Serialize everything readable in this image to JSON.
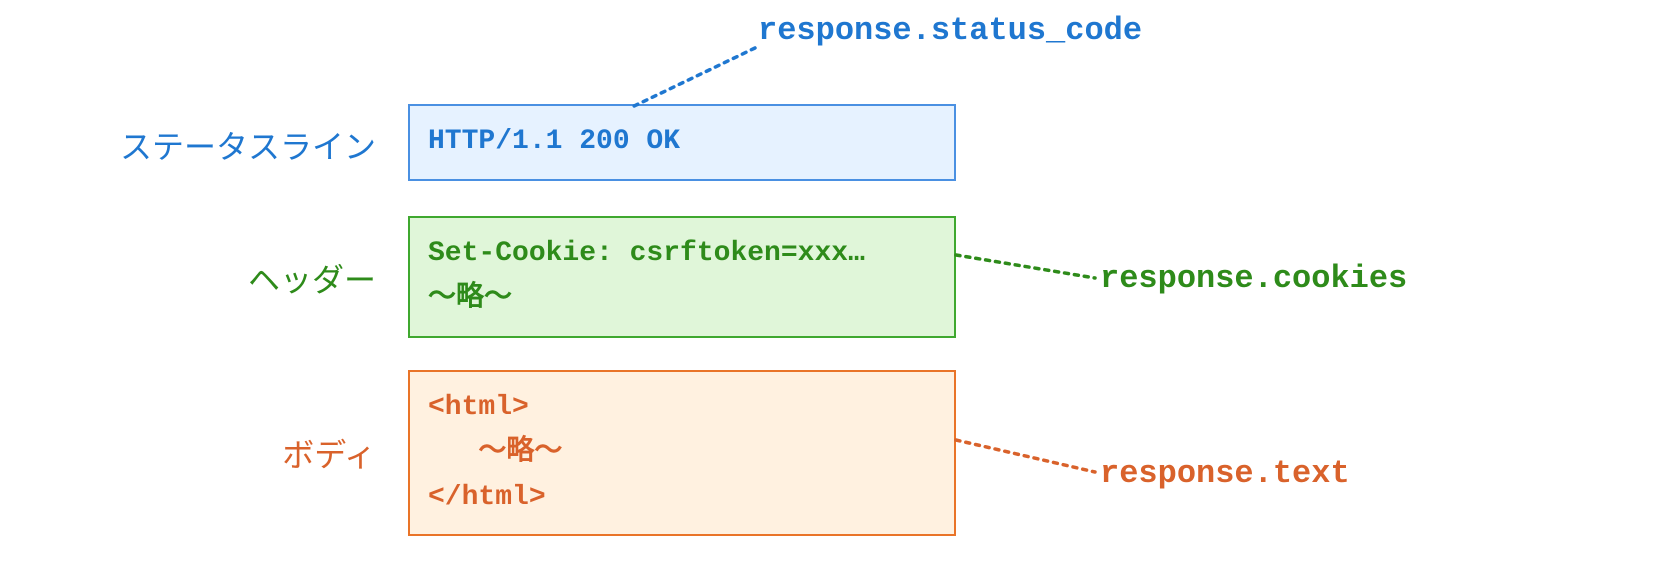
{
  "labels": {
    "status": "ステータスライン",
    "header": "ヘッダー",
    "body": "ボディ"
  },
  "boxes": {
    "status": "HTTP/1.1 200 OK",
    "header": "Set-Cookie: csrftoken=xxx…\n〜略〜",
    "body": "<html>\n   〜略〜\n</html>"
  },
  "annotations": {
    "status": "response.status_code",
    "header": "response.cookies",
    "body": "response.text"
  },
  "colors": {
    "blue": "#1f77d0",
    "green": "#2e8b1a",
    "orange": "#d9622b"
  }
}
